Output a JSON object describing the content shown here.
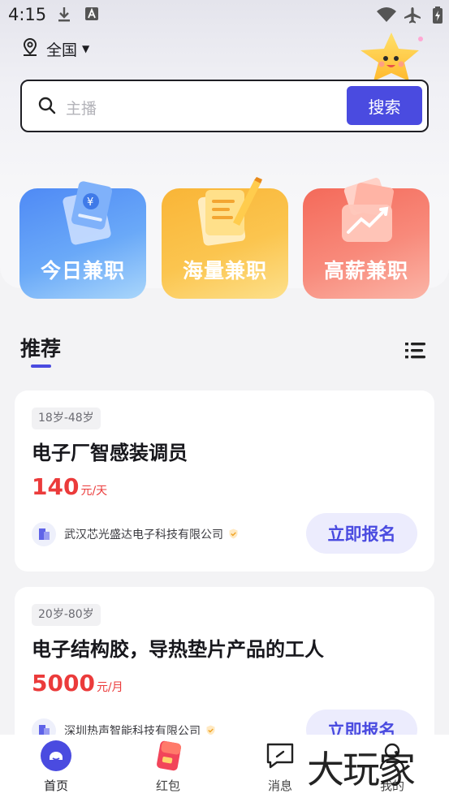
{
  "status_bar": {
    "time": "4:15"
  },
  "location": {
    "label": "全国"
  },
  "search": {
    "placeholder": "主播",
    "button_label": "搜索"
  },
  "categories": [
    {
      "label": "今日兼职",
      "color": "#5a96f6"
    },
    {
      "label": "海量兼职",
      "color": "#f9b93b"
    },
    {
      "label": "高薪兼职",
      "color": "#f5705f"
    }
  ],
  "recommend": {
    "title": "推荐"
  },
  "jobs": [
    {
      "age": "18岁-48岁",
      "title": "电子厂智感装调员",
      "salary": "140",
      "salary_unit": "元/天",
      "company": "武汉芯光盛达电子科技有限公司",
      "apply_label": "立即报名"
    },
    {
      "age": "20岁-80岁",
      "title": "电子结构胶，导热垫片产品的工人",
      "salary": "5000",
      "salary_unit": "元/月",
      "company": "深圳热声智能科技有限公司",
      "apply_label": "立即报名"
    }
  ],
  "bottom_nav": [
    {
      "label": "首页",
      "icon": "home-icon",
      "active": true
    },
    {
      "label": "红包",
      "icon": "red-envelope-icon",
      "active": false
    },
    {
      "label": "消息",
      "icon": "message-icon",
      "active": false
    },
    {
      "label": "我的",
      "icon": "profile-icon",
      "active": false
    }
  ],
  "watermark": {
    "text": "大玩家"
  },
  "colors": {
    "accent": "#4a4be0",
    "salary": "#eb3b3b"
  }
}
